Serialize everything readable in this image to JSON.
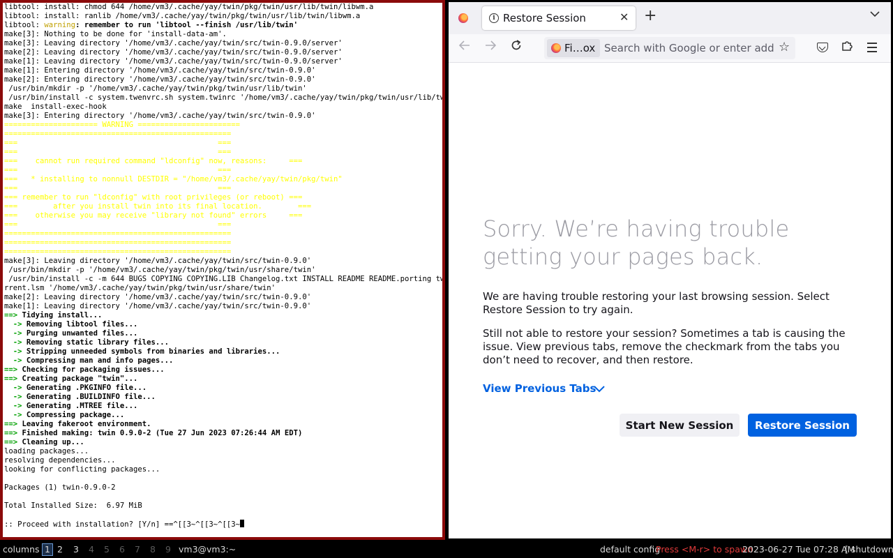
{
  "terminal": {
    "lines": [
      {
        "t": "libtool: install: chmod 644 /home/vm3/.cache/yay/twin/pkg/twin/usr/lib/twin/libwm.a"
      },
      {
        "t": "libtool: install: ranlib /home/vm3/.cache/yay/twin/pkg/twin/usr/lib/twin/libwm.a"
      },
      {
        "t": "libtool: warning: remember to run 'libtool --finish /usr/lib/twin'"
      },
      {
        "t": "make[3]: Nothing to be done for 'install-data-am'."
      },
      {
        "t": "make[3]: Leaving directory '/home/vm3/.cache/yay/twin/src/twin-0.9.0/server'"
      },
      {
        "t": "make[2]: Leaving directory '/home/vm3/.cache/yay/twin/src/twin-0.9.0/server'"
      },
      {
        "t": "make[1]: Leaving directory '/home/vm3/.cache/yay/twin/src/twin-0.9.0/server'"
      },
      {
        "t": "make[1]: Entering directory '/home/vm3/.cache/yay/twin/src/twin-0.9.0'"
      },
      {
        "t": "make[2]: Entering directory '/home/vm3/.cache/yay/twin/src/twin-0.9.0'"
      },
      {
        "t": " /usr/bin/mkdir -p '/home/vm3/.cache/yay/twin/pkg/twin/usr/lib/twin'"
      },
      {
        "t": " /usr/bin/install -c system.twenvrc.sh system.twinrc '/home/vm3/.cache/yay/twin/pkg/twin/usr/lib/twin'"
      },
      {
        "t": "make  install-exec-hook"
      },
      {
        "t": "make[3]: Entering directory '/home/vm3/.cache/yay/twin/src/twin-0.9.0'"
      },
      {
        "t": "===================== WARNING =======================",
        "c": "y"
      },
      {
        "t": "===================================================",
        "c": "y"
      },
      {
        "t": "===                                             ===",
        "c": "y"
      },
      {
        "t": "===                                             ===",
        "c": "y"
      },
      {
        "t": "===    cannot run required command \"ldconfig\" now, reasons:     ===",
        "c": "y"
      },
      {
        "t": "===                                             ===",
        "c": "y"
      },
      {
        "t": "===   * installing to nonnull DESTDIR = \"/home/vm3/.cache/yay/twin/pkg/twin\"",
        "c": "y"
      },
      {
        "t": "===                                             ===",
        "c": "y"
      },
      {
        "t": "=== remember to run \"ldconfig\" with root privileges (or reboot) ===",
        "c": "y"
      },
      {
        "t": "===        after you install twin into its final location.        ===",
        "c": "y"
      },
      {
        "t": "===    otherwise you may receive \"library not found\" errors     ===",
        "c": "y"
      },
      {
        "t": "===                                             ===",
        "c": "y"
      },
      {
        "t": "===================================================",
        "c": "y"
      },
      {
        "t": "===================================================",
        "c": "y"
      },
      {
        "t": "===================================================",
        "c": "y"
      },
      {
        "t": "make[3]: Leaving directory '/home/vm3/.cache/yay/twin/src/twin-0.9.0'"
      },
      {
        "t": " /usr/bin/mkdir -p '/home/vm3/.cache/yay/twin/pkg/twin/usr/share/twin'"
      },
      {
        "t": " /usr/bin/install -c -m 644 BUGS COPYING COPYING.LIB Changelog.txt INSTALL README README.porting twin-cu"
      },
      {
        "t": "rrent.lsm '/home/vm3/.cache/yay/twin/pkg/twin/usr/share/twin'"
      },
      {
        "t": "make[2]: Leaving directory '/home/vm3/.cache/yay/twin/src/twin-0.9.0'"
      },
      {
        "t": "make[1]: Leaving directory '/home/vm3/.cache/yay/twin/src/twin-0.9.0'"
      },
      {
        "p": "==>",
        "t": " Tidying install...",
        "c": "bold"
      },
      {
        "p": "  ->",
        "t": " Removing libtool files...",
        "c": "bold"
      },
      {
        "p": "  ->",
        "t": " Purging unwanted files...",
        "c": "bold"
      },
      {
        "p": "  ->",
        "t": " Removing static library files...",
        "c": "bold"
      },
      {
        "p": "  ->",
        "t": " Stripping unneeded symbols from binaries and libraries...",
        "c": "bold"
      },
      {
        "p": "  ->",
        "t": " Compressing man and info pages...",
        "c": "bold"
      },
      {
        "p": "==>",
        "t": " Checking for packaging issues...",
        "c": "bold"
      },
      {
        "p": "==>",
        "t": " Creating package \"twin\"...",
        "c": "bold"
      },
      {
        "p": "  ->",
        "t": " Generating .PKGINFO file...",
        "c": "bold"
      },
      {
        "p": "  ->",
        "t": " Generating .BUILDINFO file...",
        "c": "bold"
      },
      {
        "p": "  ->",
        "t": " Generating .MTREE file...",
        "c": "bold"
      },
      {
        "p": "  ->",
        "t": " Compressing package...",
        "c": "bold"
      },
      {
        "p": "==>",
        "t": " Leaving fakeroot environment.",
        "c": "bold"
      },
      {
        "p": "==>",
        "t": " Finished making: twin 0.9.0-2 (Tue 27 Jun 2023 07:26:44 AM EDT)",
        "c": "bold"
      },
      {
        "p": "==>",
        "t": " Cleaning up...",
        "c": "bold"
      },
      {
        "t": "loading packages..."
      },
      {
        "t": "resolving dependencies..."
      },
      {
        "t": "looking for conflicting packages..."
      },
      {
        "t": ""
      },
      {
        "t": "Packages (1) twin-0.9.0-2"
      },
      {
        "t": ""
      },
      {
        "t": "Total Installed Size:  6.97 MiB"
      },
      {
        "t": ""
      },
      {
        "t": ":: Proceed with installation? [Y/n] ==^[[3~^[[3~^[[3~",
        "cursor": true
      }
    ],
    "warning_word": "warning"
  },
  "browser": {
    "tab_title": "Restore Session",
    "new_tab": "+",
    "identity_label": "Fi…ox",
    "url_placeholder": "Search with Google or enter address",
    "heading": "Sorry. We’re having trouble getting your pages back.",
    "para1": "We are having trouble restoring your last browsing session. Select Restore Session to try again.",
    "para2": "Still not able to restore your session? Sometimes a tab is causing the issue. View previous tabs, remove the checkmark from the tabs you don’t need to recover, and then restore.",
    "view_previous": "View Previous Tabs",
    "start_new": "Start New Session",
    "restore": "Restore Session",
    "accent": "#0061e0"
  },
  "statusbar": {
    "layout": "columns",
    "workspaces": [
      "1",
      "2",
      "3",
      "4",
      "5",
      "6",
      "7",
      "8",
      "9"
    ],
    "active_workspace": "1",
    "window_title": "vm3@vm3:~",
    "config": "default config",
    "spawn_hint": "Press <M-r> to spawn",
    "datetime": "2023-06-27 Tue 07:28 AM",
    "shutdown": "[ shutdown ]"
  }
}
